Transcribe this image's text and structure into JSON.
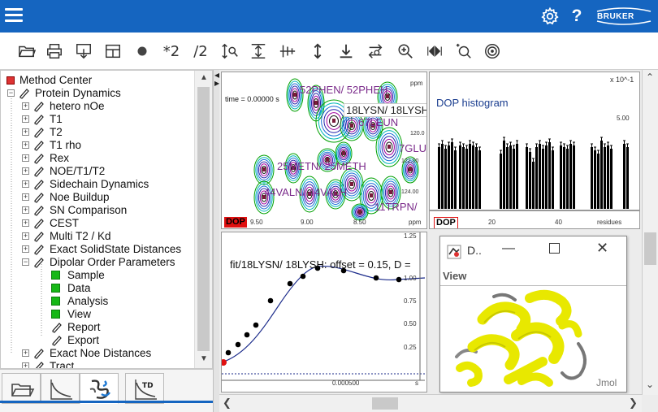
{
  "brand": {
    "name": "BRUKER",
    "color": "#1565c0"
  },
  "titlebar": {
    "icons": [
      "menu-icon",
      "settings-icon",
      "help-icon"
    ],
    "help_label": "?"
  },
  "toolbar": {
    "items": [
      {
        "name": "open-folder-icon"
      },
      {
        "name": "print-icon"
      },
      {
        "name": "export-icon"
      },
      {
        "name": "layout-grid-icon"
      },
      {
        "name": "record-dot-icon"
      },
      {
        "name": "multiply-two",
        "label": "*2"
      },
      {
        "name": "divide-two",
        "label": "/2"
      },
      {
        "name": "scale-icon"
      },
      {
        "name": "fit-vertical-icon"
      },
      {
        "name": "align-icon"
      },
      {
        "name": "updown-icon"
      },
      {
        "name": "download-icon"
      },
      {
        "name": "swap-icon"
      },
      {
        "name": "zoom-in-icon"
      },
      {
        "name": "step-icon"
      },
      {
        "name": "zoom-fit-icon"
      },
      {
        "name": "target-icon"
      }
    ]
  },
  "tree": {
    "root": "Method Center",
    "group": "Protein Dynamics",
    "items": [
      "hetero nOe",
      "T1",
      "T2",
      "T1 rho",
      "Rex",
      "NOE/T1/T2",
      "Sidechain Dynamics",
      "Noe Buildup",
      "SN Comparison",
      "CEST",
      "Multi T2 / Kd",
      "Exact SolidState Distances",
      "Dipolar Order Parameters"
    ],
    "children": [
      {
        "label": "Sample",
        "icon": "green"
      },
      {
        "label": "Data",
        "icon": "green"
      },
      {
        "label": "Analysis",
        "icon": "green"
      },
      {
        "label": "View",
        "icon": "green"
      },
      {
        "label": "Report",
        "icon": "pencil"
      },
      {
        "label": "Export",
        "icon": "pencil"
      }
    ],
    "after": [
      "Exact Noe Distances",
      "Tract"
    ]
  },
  "bottom_tabs": [
    "open-folder-tab",
    "decay-curve-tab",
    "molecule-tab",
    "td-tab"
  ],
  "bottom_tab_td": "TD",
  "spectrum": {
    "time_label": "time = 0.00000 s",
    "ppm_label": "ppm",
    "peaks": [
      "52PHEN/ 52PHEH",
      "18LYSN/ 18LYSH",
      "25METN/ 25METH",
      "44VALN/ 44VALH",
      "11TRPN/",
      "67LEUN",
      "7GLU"
    ],
    "y_ticks": [
      "120.0",
      "122.00",
      "124.00"
    ],
    "x_ticks": [
      "9.50",
      "9.00",
      "8.50",
      "ppm"
    ],
    "badge": "DOP"
  },
  "histogram": {
    "title": "DOP histogram",
    "scale": "x 10^-1",
    "y_ticks": [
      "5.00",
      "0.00"
    ],
    "x_ticks": [
      "20",
      "40"
    ],
    "x_label": "residues",
    "badge": "DOP"
  },
  "fit": {
    "title": "fit/18LYSN/ 18LYSH: offset = 0.15, D =",
    "y_ticks": [
      "1.25",
      "1.00",
      "0.75",
      "0.50",
      "0.25"
    ],
    "x_ticks": [
      "0.000500",
      "s"
    ]
  },
  "jmol": {
    "title": "D..",
    "menu": "View",
    "watermark": "Jmol"
  }
}
